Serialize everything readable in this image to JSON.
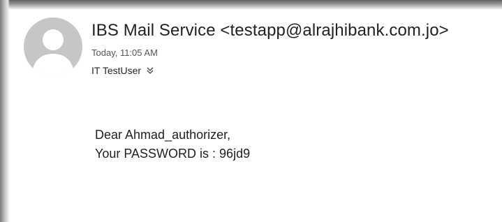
{
  "message": {
    "sender": "IBS Mail Service <testapp@alrajhibank.com.jo>",
    "timestamp": "Today, 11:05 AM",
    "recipient": "IT TestUser",
    "body": {
      "greeting": "Dear Ahmad_authorizer,",
      "password_line": "Your PASSWORD is : 96jd9"
    }
  },
  "icons": {
    "avatar": "person-avatar-icon",
    "expand": "double-chevron-down-icon"
  },
  "colors": {
    "avatar_bg": "#c6c6c6",
    "avatar_figure": "#ffffff",
    "text_primary": "#222222",
    "text_secondary": "#555555"
  }
}
